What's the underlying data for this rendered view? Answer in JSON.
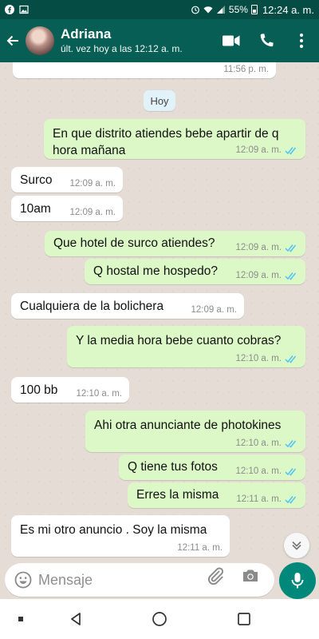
{
  "status_bar": {
    "battery": "55%",
    "time": "12:24 a. m."
  },
  "header": {
    "contact_name": "Adriana",
    "last_seen": "últ. vez hoy a las 12:12 a. m."
  },
  "chat": {
    "day_label": "Hoy",
    "partial_message_time": "11:56 p. m.",
    "messages": [
      {
        "direction": "out",
        "text_line1": "En que distrito atiendes bebe apartir de q",
        "text_line2": "hora mañana",
        "time": "12:09 a. m.",
        "status": "read"
      },
      {
        "direction": "in",
        "text": "Surco",
        "time": "12:09 a. m."
      },
      {
        "direction": "in",
        "text": "10am",
        "time": "12:09 a. m."
      },
      {
        "direction": "out",
        "text": "Que hotel de surco atiendes?",
        "time": "12:09 a. m.",
        "status": "read"
      },
      {
        "direction": "out",
        "text": "Q hostal me hospedo?",
        "time": "12:09 a. m.",
        "status": "read"
      },
      {
        "direction": "in",
        "text": "Cualquiera de la bolichera",
        "time": "12:09 a. m."
      },
      {
        "direction": "out",
        "text": "Y la media hora bebe cuanto cobras?",
        "time": "12:10 a. m.",
        "status": "read"
      },
      {
        "direction": "in",
        "text": "100 bb",
        "time": "12:10 a. m."
      },
      {
        "direction": "out",
        "text": "Ahi otra anunciante de photokines",
        "time": "12:10 a. m.",
        "status": "read"
      },
      {
        "direction": "out",
        "text": "Q tiene tus fotos",
        "time": "12:10 a. m.",
        "status": "read"
      },
      {
        "direction": "out",
        "text": "Erres la misma",
        "time": "12:11 a. m.",
        "status": "read"
      },
      {
        "direction": "in",
        "text": "Es mi otro anuncio . Soy la misma",
        "time": "12:11 a. m."
      }
    ]
  },
  "composer": {
    "placeholder": "Mensaje"
  },
  "colors": {
    "header": "#075e54",
    "status_bar": "#054d44",
    "outgoing_bubble": "#dcf8c6",
    "incoming_bubble": "#ffffff",
    "read_ticks": "#4fc3f7",
    "mic_button": "#00897b"
  },
  "icons": [
    "facebook-icon",
    "gallery-icon",
    "alarm-icon",
    "wifi-icon",
    "signal-icon",
    "battery-icon",
    "back-arrow-icon",
    "video-call-icon",
    "phone-icon",
    "more-options-icon",
    "emoji-icon",
    "attach-icon",
    "camera-icon",
    "mic-icon",
    "chevron-double-down-icon",
    "nav-recents-icon",
    "nav-back-icon",
    "nav-home-icon",
    "nav-overview-icon"
  ]
}
